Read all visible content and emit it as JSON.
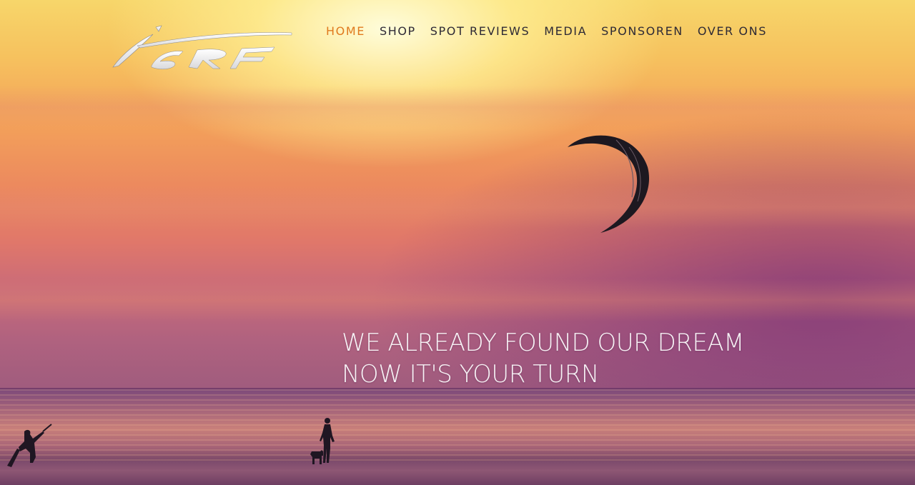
{
  "brand": {
    "logo_text": "iSRF"
  },
  "nav": {
    "items": [
      {
        "label": "HOME",
        "active": true
      },
      {
        "label": "SHOP",
        "active": false
      },
      {
        "label": "SPOT REVIEWS",
        "active": false
      },
      {
        "label": "MEDIA",
        "active": false
      },
      {
        "label": "SPONSOREN",
        "active": false
      },
      {
        "label": "OVER ONS",
        "active": false
      }
    ],
    "active_color": "#e07a1e",
    "text_color": "#2e2a35"
  },
  "hero": {
    "line1": "WE ALREADY FOUND OUR DREAM",
    "line2": "NOW IT'S YOUR TURN"
  },
  "icons": {
    "kite": "kite-silhouette",
    "kitesurfer": "kitesurfer-silhouette",
    "walker": "person-with-dog-silhouette"
  }
}
